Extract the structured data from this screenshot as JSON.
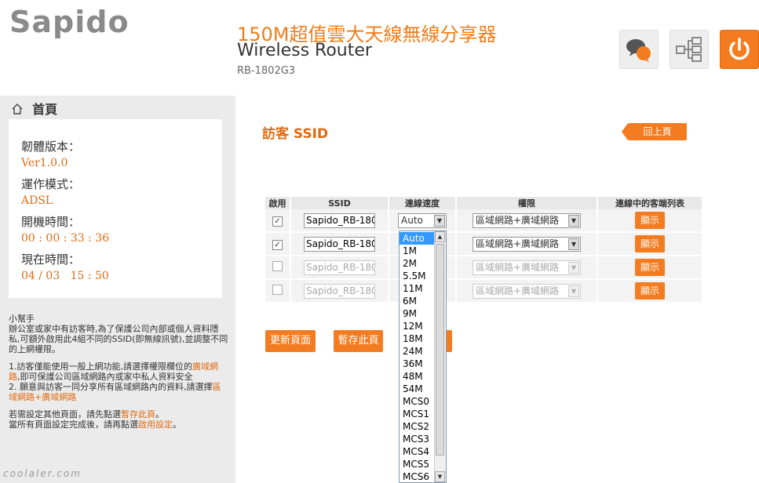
{
  "header": {
    "logo": "Sapido",
    "product_title": "150M超值雲大天線無線分享器",
    "product_subtitle": "Wireless Router",
    "model": "RB-1802G3",
    "icons": [
      "chat-icon",
      "network-icon",
      "power-icon"
    ]
  },
  "sidebar": {
    "home_label": "首頁",
    "status": {
      "firmware_label": "韌體版本：",
      "firmware_value": "Ver1.0.0",
      "mode_label": "運作模式：",
      "mode_value": "ADSL",
      "uptime_label": "開機時間：",
      "uptime_value": "00 : 00 : 33 : 36",
      "time_label": "現在時間：",
      "time_value": "04 / 03   15 : 50"
    },
    "help": {
      "title": "小幫手",
      "p1": "辦公室或家中有訪客時,為了保護公司內部或個人資料隱私,可額外啟用此4組不同的SSID(即無線訊號),並調整不同的上網權限。",
      "p2_a": "1.訪客僅能使用一般上網功能,請選擇權限欄位的",
      "p2_hl": "廣域網路",
      "p2_b": ",即可保護公司區域網路內或家中私人資料安全",
      "p3_a": "2. 願意與訪客一同分享所有區域網路內的資料,請選擇",
      "p3_hl": "區域網路+廣域網路",
      "p4_a": "若需設定其他頁面，請先點選",
      "p4_hl": "暫存此頁",
      "p4_b": "。",
      "p5_a": "當所有頁面設定完成後，請再點選",
      "p5_hl": "啟用設定",
      "p5_b": "。"
    },
    "watermark": "coolaler.com"
  },
  "main": {
    "heading": "訪客 SSID",
    "back_label": "回上頁",
    "table": {
      "headers": [
        "啟用",
        "SSID",
        "連線速度",
        "權限",
        "連線中的客端列表"
      ],
      "rows": [
        {
          "checked": "✓",
          "ssid": "Sapido_RB-180",
          "speed": "Auto",
          "perm": "區域網路+廣域網路",
          "show": "顯示"
        },
        {
          "checked": "✓",
          "ssid": "Sapido_RB-180",
          "speed": "",
          "perm": "區域網路+廣域網路",
          "show": "顯示"
        },
        {
          "checked": "",
          "ssid": "Sapido_RB-180",
          "speed": "",
          "perm": "區域網路+廣域網路",
          "show": "顯示"
        },
        {
          "checked": "",
          "ssid": "Sapido_RB-180",
          "speed": "",
          "perm": "區域網路+廣域網路",
          "show": "顯示"
        }
      ]
    },
    "refresh_label": "更新頁面",
    "save_label": "暫存此頁",
    "speed_options": [
      "Auto",
      "1M",
      "2M",
      "5.5M",
      "11M",
      "6M",
      "9M",
      "12M",
      "18M",
      "24M",
      "36M",
      "48M",
      "54M",
      "MCS0",
      "MCS1",
      "MCS2",
      "MCS3",
      "MCS4",
      "MCS5",
      "MCS6"
    ],
    "speed_selected": "Auto"
  }
}
